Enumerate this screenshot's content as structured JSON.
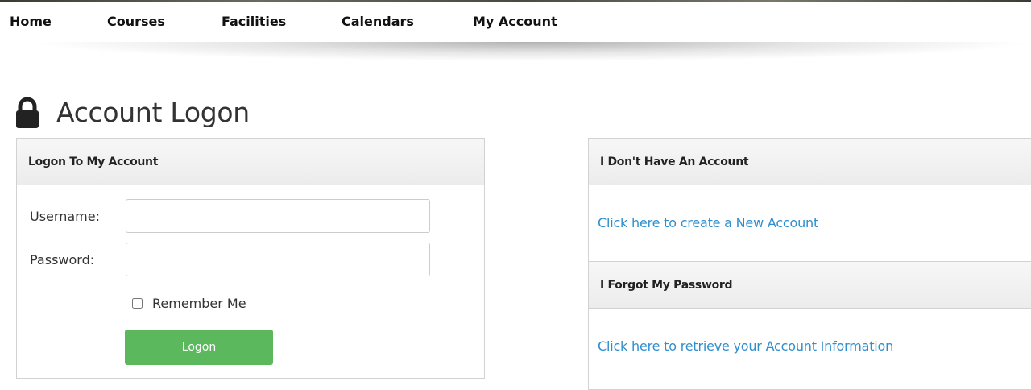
{
  "nav": {
    "items": [
      {
        "label": "Home"
      },
      {
        "label": "Courses"
      },
      {
        "label": "Facilities"
      },
      {
        "label": "Calendars"
      },
      {
        "label": "My Account"
      }
    ]
  },
  "page": {
    "title": "Account Logon",
    "title_icon": "lock-icon"
  },
  "login_panel": {
    "header": "Logon To My Account",
    "username_label": "Username:",
    "username_value": "",
    "password_label": "Password:",
    "password_value": "",
    "remember_label": "Remember Me",
    "remember_checked": false,
    "logon_label": "Logon"
  },
  "signup_panel": {
    "header": "I Don't Have An Account",
    "link": "Click here to create a New Account"
  },
  "forgot_panel": {
    "header": "I Forgot My Password",
    "link": "Click here to retrieve your Account Information"
  },
  "colors": {
    "link": "#2f8fcd",
    "primary_button": "#5cb85c",
    "panel_header_bg": "#f2f2f2",
    "border": "#d2d2d2"
  }
}
